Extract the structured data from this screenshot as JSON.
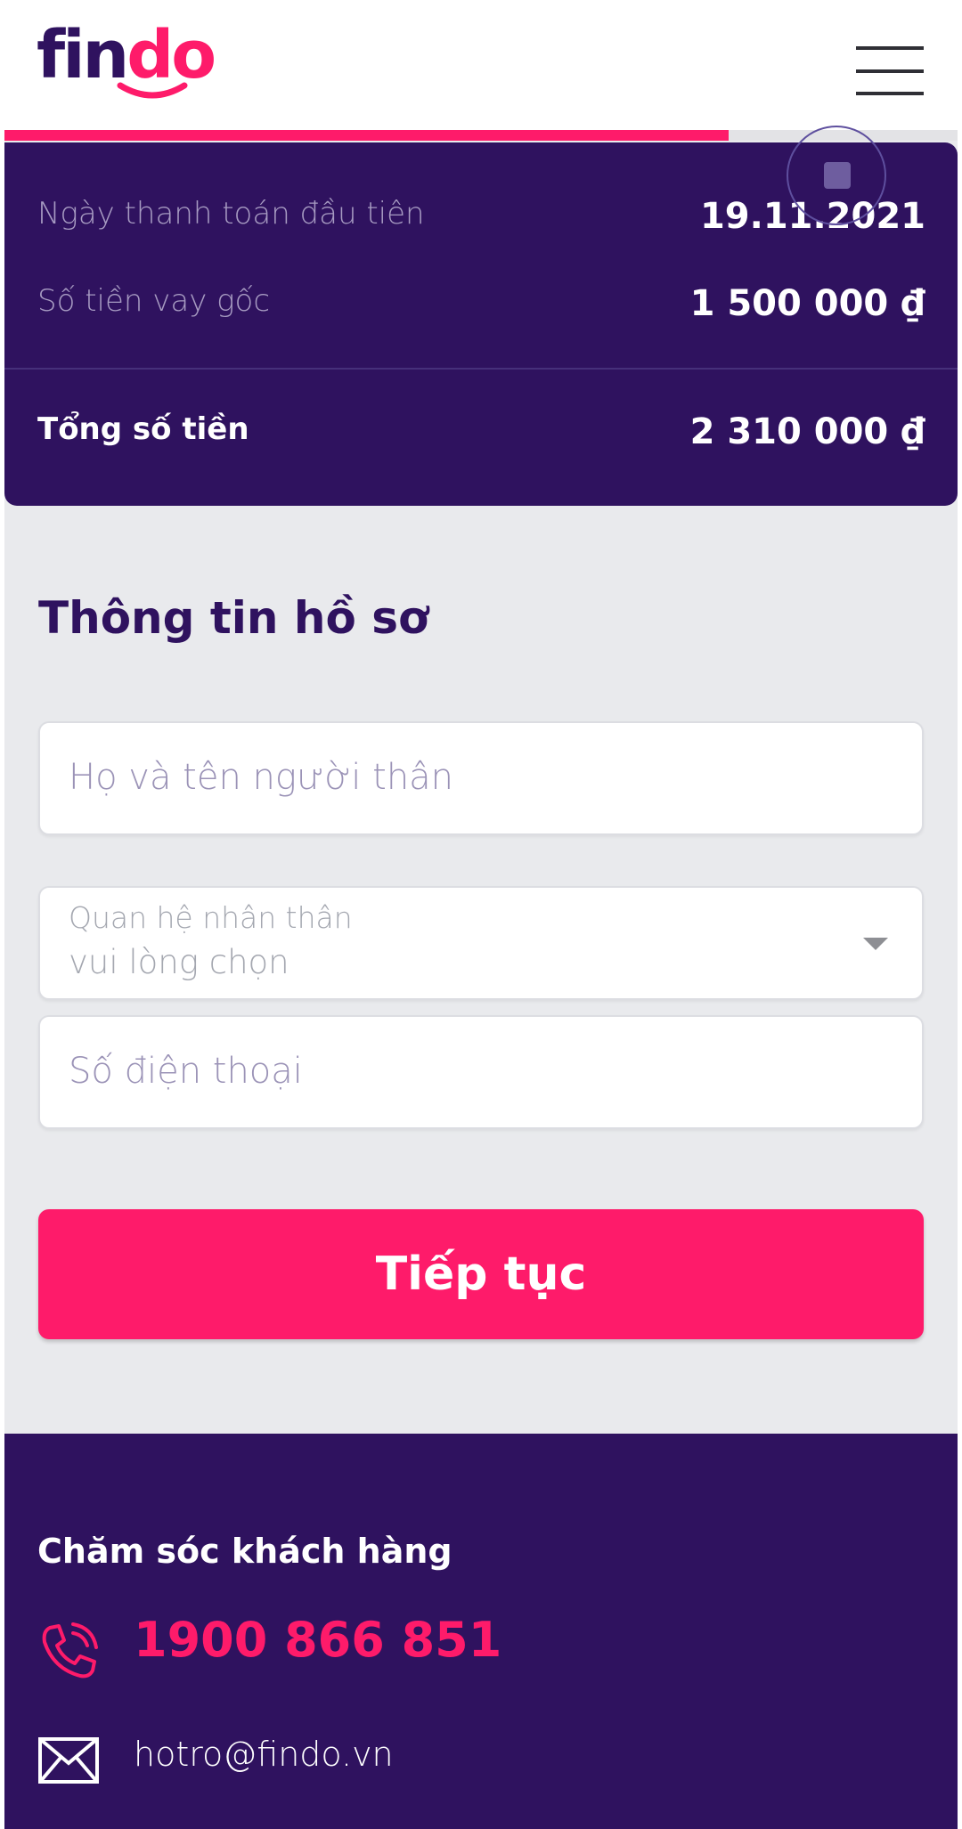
{
  "brand": {
    "logo_part1": "fin",
    "logo_part2": "do",
    "primary_color": "#2f125f",
    "accent_color": "#fe1b6a"
  },
  "header": {
    "menu_icon": "hamburger-menu-icon"
  },
  "progress": {
    "fraction": 0.76
  },
  "summary": {
    "first_payment_label": "Ngày thanh toán đầu tiên",
    "first_payment_value": "19.11.2021",
    "principal_label": "Số tiền vay gốc",
    "principal_value": "1 500 000 ₫",
    "total_label": "Tổng số tiền",
    "total_value": "2 310 000 ₫"
  },
  "form": {
    "title": "Thông tin hồ sơ",
    "relative_name_placeholder": "Họ và tên người thân",
    "relationship_label": "Quan hệ nhân thân",
    "relationship_value": "vui lòng chọn",
    "phone_placeholder": "Số điện thoại",
    "submit_label": "Tiếp tục"
  },
  "footer": {
    "title": "Chăm sóc khách hàng",
    "phone_icon": "phone-icon",
    "phone": "1900 866 851",
    "mail_icon": "mail-icon",
    "email": "hotro@findo.vn"
  }
}
